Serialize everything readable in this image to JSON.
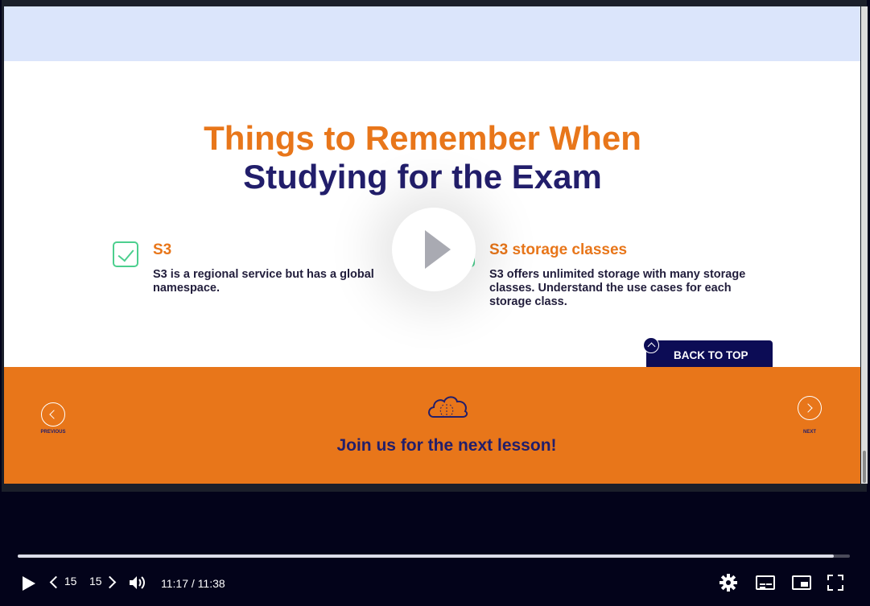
{
  "slide": {
    "title_line1": "Things to Remember When",
    "title_line2": "Studying for the Exam",
    "points": [
      {
        "heading": "S3",
        "body": "S3 is a regional service but has a global namespace."
      },
      {
        "heading": "S3 storage classes",
        "body": "S3 offers unlimited storage with many storage classes. Understand the use cases for each storage class."
      }
    ],
    "back_to_top_label": "BACK TO TOP",
    "footer": {
      "previous_label": "PREVIOUS",
      "next_label": "NEXT",
      "cta_text": "Join us for the next lesson!"
    }
  },
  "player": {
    "progress_fraction": 0.981,
    "rewind_label": "15",
    "forward_label": "15",
    "time_display": "11:17 / 11:38",
    "icons": [
      "play-icon",
      "rewind-icon",
      "forward-icon",
      "volume-icon",
      "gear-icon",
      "captions-icon",
      "pip-icon",
      "fullscreen-icon"
    ]
  },
  "colors": {
    "accent_orange": "#e8761a",
    "navy": "#221e6b",
    "check_green": "#4ccf8e",
    "player_bg": "#03031a"
  }
}
